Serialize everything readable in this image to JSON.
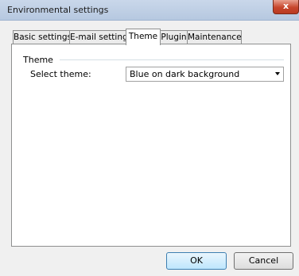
{
  "window": {
    "title": "Environmental settings",
    "close_symbol": "x"
  },
  "tabs": [
    {
      "label": "Basic settings",
      "active": false
    },
    {
      "label": "E-mail settings",
      "active": false
    },
    {
      "label": "Theme",
      "active": true
    },
    {
      "label": "Plugin",
      "active": false
    },
    {
      "label": "Maintenance",
      "active": false
    }
  ],
  "theme_group": {
    "label": "Theme",
    "select_label": "Select theme:",
    "selected_value": "Blue on dark background"
  },
  "buttons": {
    "ok_label": "OK",
    "cancel_label": "Cancel"
  }
}
